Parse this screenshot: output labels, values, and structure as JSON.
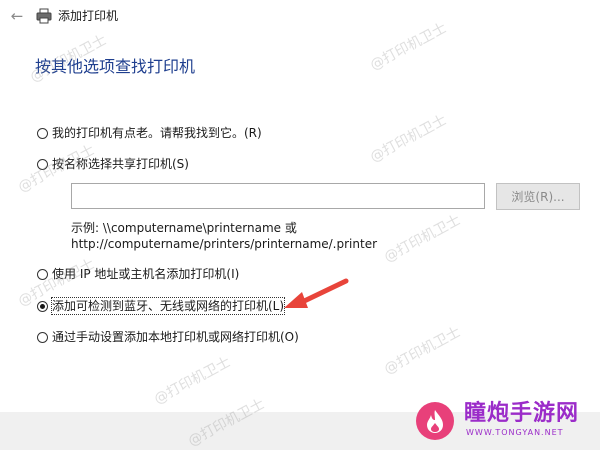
{
  "window": {
    "title": "添加打印机",
    "back_icon": "back-arrow-icon",
    "printer_icon": "printer-icon"
  },
  "heading": "按其他选项查找打印机",
  "options": [
    {
      "label": "我的打印机有点老。请帮我找到它。(R)",
      "checked": false
    },
    {
      "label": "按名称选择共享打印机(S)",
      "checked": false
    },
    {
      "label": "使用 IP 地址或主机名添加打印机(I)",
      "checked": false
    },
    {
      "label": "添加可检测到蓝牙、无线或网络的打印机(L)",
      "checked": true
    },
    {
      "label": "通过手动设置添加本地打印机或网络打印机(O)",
      "checked": false
    }
  ],
  "shared_printer": {
    "input_value": "",
    "browse_label": "浏览(R)...",
    "example_line1": "示例: \\\\computername\\printername 或",
    "example_line2": "http://computername/printers/printername/.printer"
  },
  "watermark": {
    "text": "@打印机卫士"
  },
  "logo": {
    "text": "瞳炮手游网",
    "url": "WWW.TONGYAN.NET"
  },
  "colors": {
    "heading": "#1f3f8f",
    "arrow": "#e8443a",
    "footer": "#f0f0f0",
    "logo_pink": "#e8407a",
    "logo_purple": "#9b2cc9"
  }
}
